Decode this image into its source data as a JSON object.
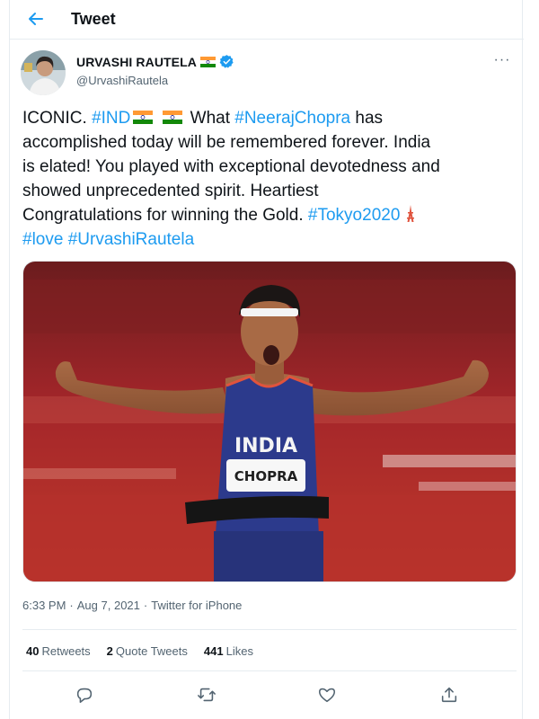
{
  "header": {
    "back_icon": "arrow-left-icon",
    "title": "Tweet"
  },
  "author": {
    "display_name": "URVASHI RAUTELA",
    "handle": "@UrvashiRautela",
    "flag_icon": "india-flag-icon",
    "verified_icon": "verified-badge-icon",
    "more_label": "···"
  },
  "tweet": {
    "line1": {
      "pre": "ICONIC. ",
      "tag": "#IND",
      "post_after_flags": " What ",
      "tag2": "#NeerajChopra",
      "post": " has"
    },
    "line2": "accomplished today will be remembered forever. India",
    "line3": "is elated! You played with exceptional devotedness and",
    "line4": "showed unprecedented spirit. Heartiest",
    "line5": {
      "pre": "Congratulations  for winning the Gold. ",
      "tag": "#Tokyo2020"
    },
    "line6": {
      "tag1": "#love",
      "space": " ",
      "tag2": "#UrvashiRautela"
    }
  },
  "photo": {
    "vest_text": "INDIA",
    "bib_text": "CHOPRA"
  },
  "meta": {
    "time": "6:33 PM",
    "separator": "·",
    "date": "Aug 7, 2021",
    "source": "Twitter for iPhone"
  },
  "stats": {
    "retweets_count": "40",
    "retweets_label": "Retweets",
    "quotes_count": "2",
    "quotes_label": "Quote Tweets",
    "likes_count": "441",
    "likes_label": "Likes"
  },
  "actions": {
    "reply_icon": "reply-icon",
    "retweet_icon": "retweet-icon",
    "like_icon": "heart-icon",
    "share_icon": "share-icon"
  },
  "colors": {
    "accent": "#1d9bf0",
    "text": "#0f1419",
    "secondary": "#536471",
    "border": "#e6ecf0"
  }
}
